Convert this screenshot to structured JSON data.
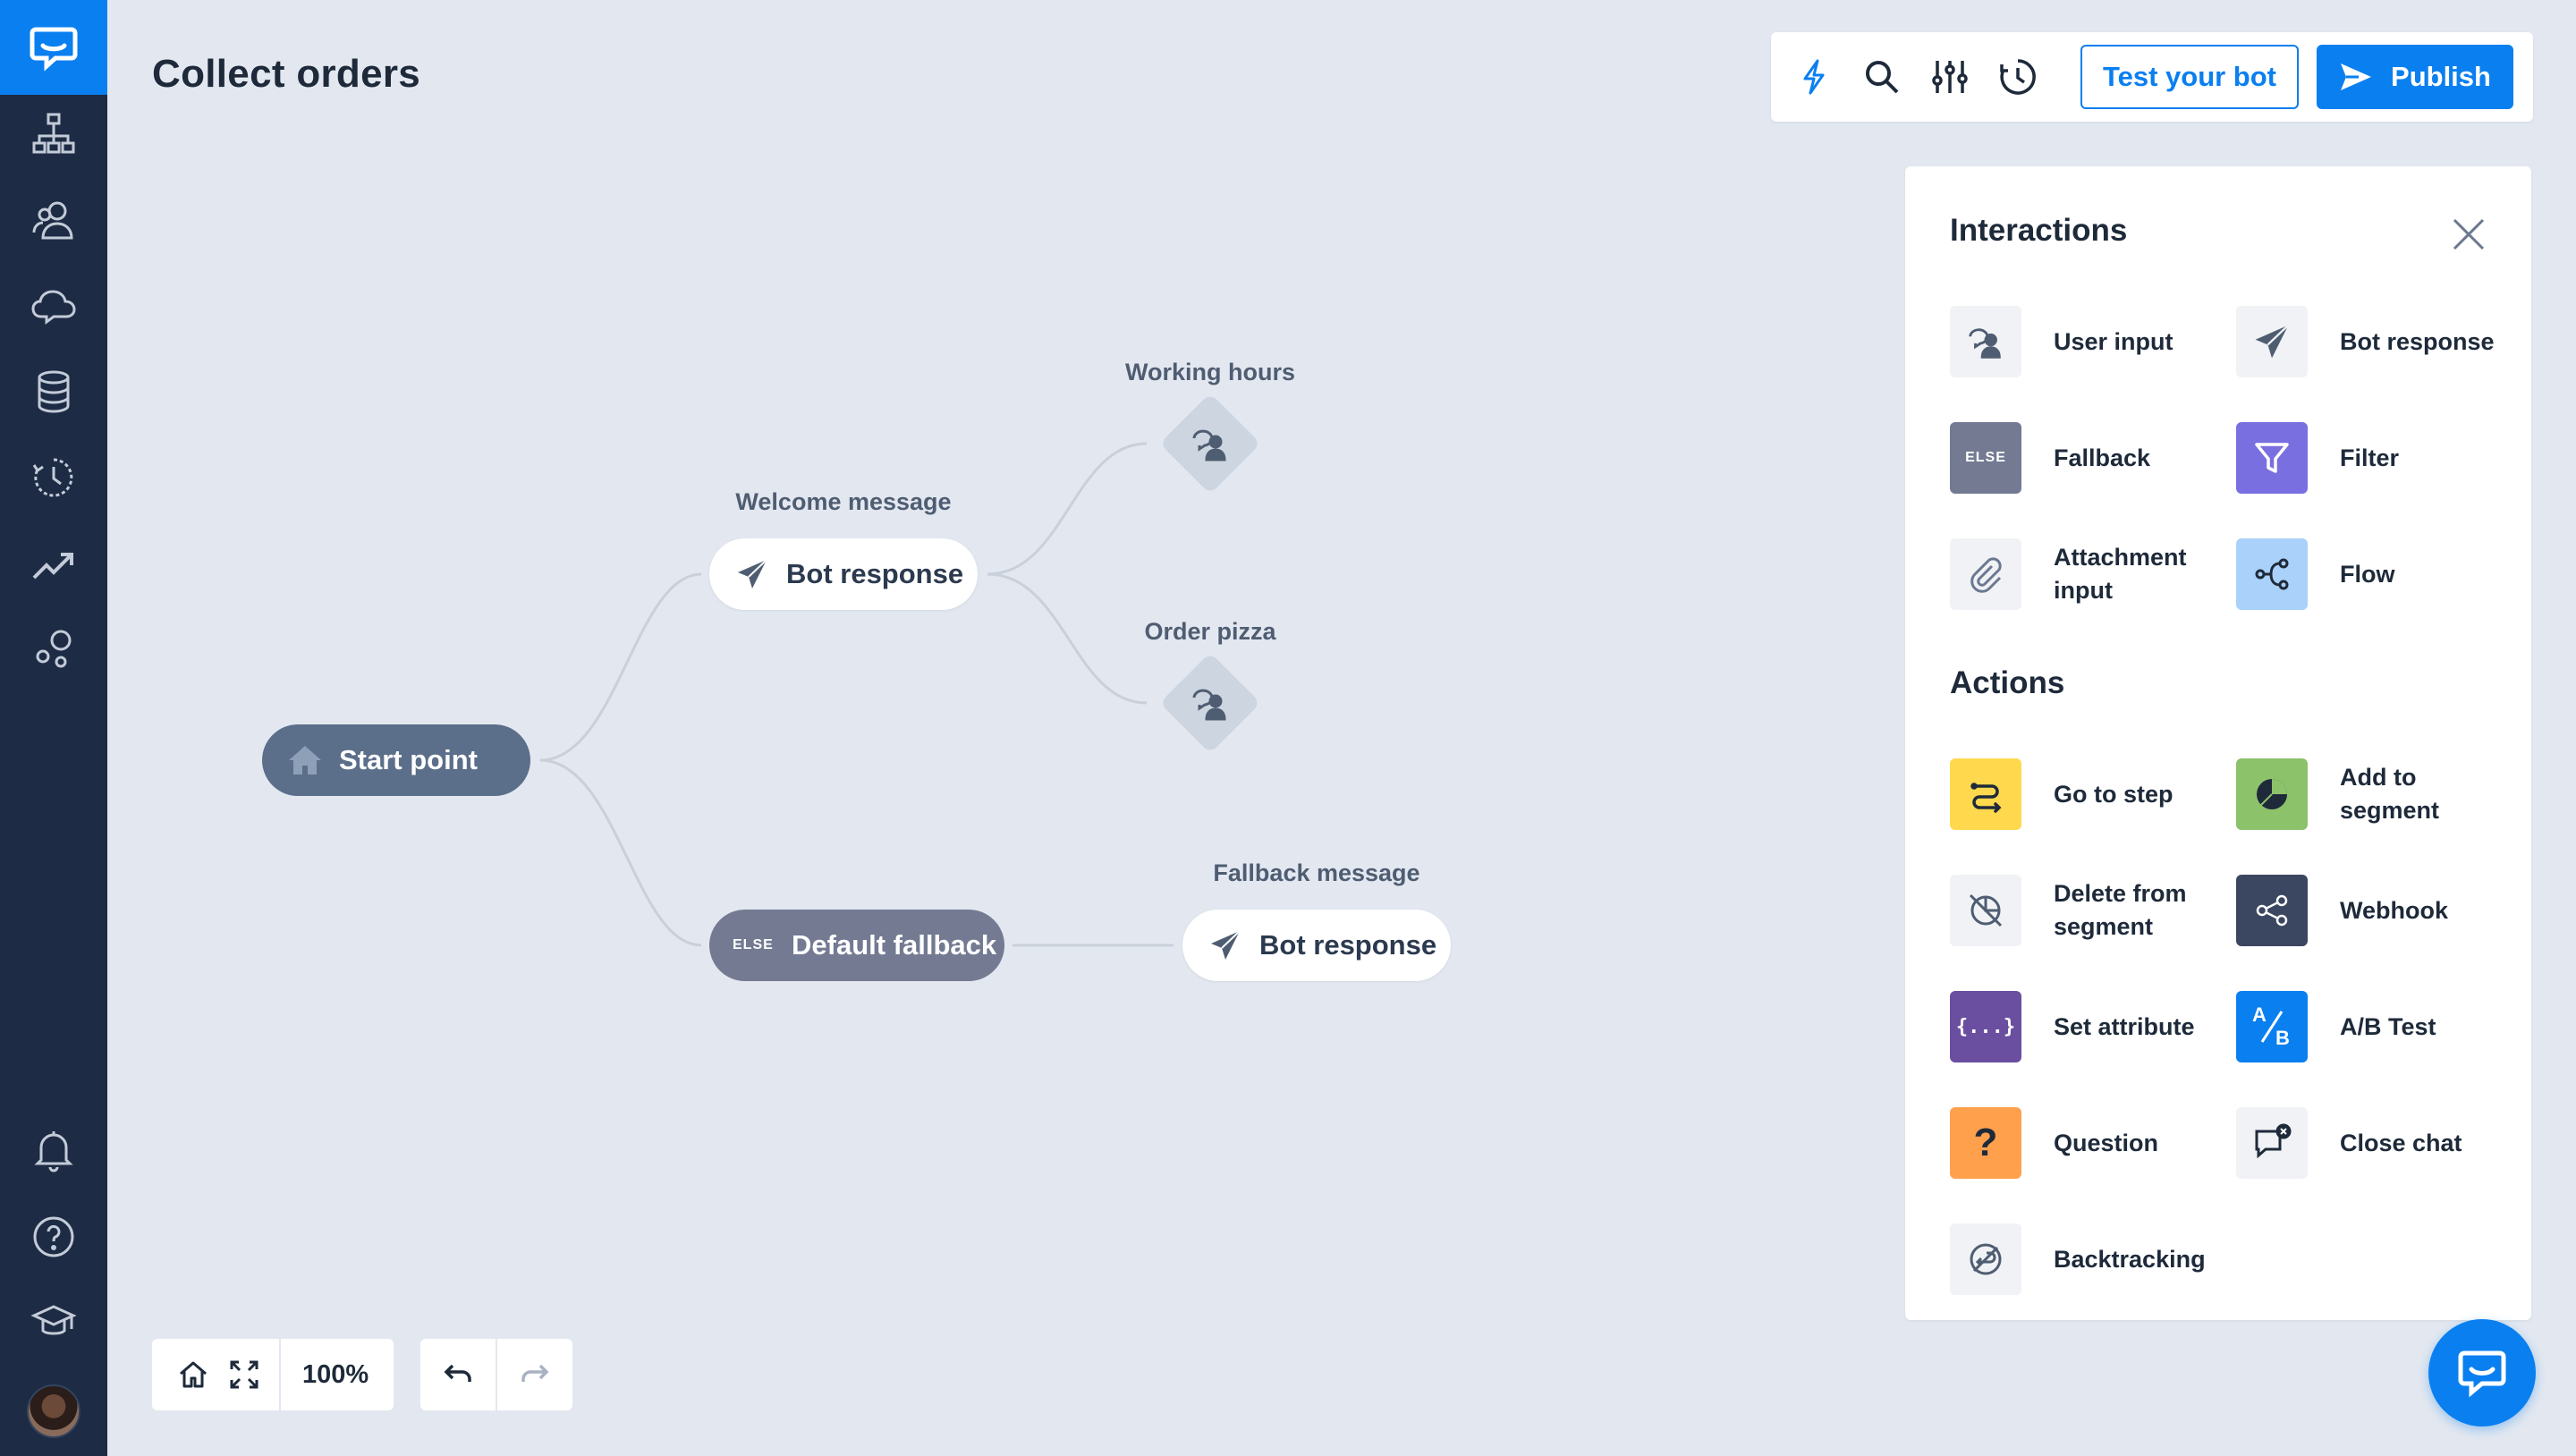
{
  "app": {
    "title": "Collect orders",
    "accent": "#0a7ff0"
  },
  "sidebar": {
    "logo_icon": "chatbot-logo-icon",
    "items": [
      {
        "icon": "hierarchy-icon"
      },
      {
        "icon": "users-icon"
      },
      {
        "icon": "chat-cloud-icon"
      },
      {
        "icon": "database-icon"
      },
      {
        "icon": "history-clock-icon"
      },
      {
        "icon": "analytics-trend-icon"
      },
      {
        "icon": "integrations-bubbles-icon"
      }
    ],
    "bottom_items": [
      {
        "icon": "bell-icon"
      },
      {
        "icon": "help-icon"
      },
      {
        "icon": "graduation-cap-icon"
      }
    ]
  },
  "toolbar": {
    "icons": [
      "lightning-icon",
      "search-icon",
      "sliders-icon",
      "history-icon"
    ],
    "test_label": "Test your bot",
    "publish_label": "Publish"
  },
  "canvas": {
    "start": {
      "label": "Start point"
    },
    "welcome": {
      "caption": "Welcome message",
      "label": "Bot response"
    },
    "working_hours": {
      "caption": "Working hours"
    },
    "order_pizza": {
      "caption": "Order pizza"
    },
    "fallback": {
      "tag": "ELSE",
      "label": "Default fallback"
    },
    "fallback_msg": {
      "caption": "Fallback message",
      "label": "Bot response"
    }
  },
  "panel": {
    "interactions_title": "Interactions",
    "interactions": [
      {
        "label": "User input",
        "icon": "user-input-icon",
        "color": "#f0f2f5"
      },
      {
        "label": "Bot response",
        "icon": "paper-plane-icon",
        "color": "#f0f2f5"
      },
      {
        "label": "Fallback",
        "icon": "else-icon",
        "color": "#737a92",
        "tag": "ELSE"
      },
      {
        "label": "Filter",
        "icon": "funnel-icon",
        "color": "#7a6fe0"
      },
      {
        "label": "Attachment input",
        "icon": "paperclip-icon",
        "color": "#f0f2f5"
      },
      {
        "label": "Flow",
        "icon": "flow-icon",
        "color": "#a9d1fa"
      }
    ],
    "actions_title": "Actions",
    "actions": [
      {
        "label": "Go to step",
        "icon": "go-to-step-icon",
        "color": "#ffd84d"
      },
      {
        "label": "Add to segment",
        "icon": "pie-segment-icon",
        "color": "#8cc26a"
      },
      {
        "label": "Delete from segment",
        "icon": "segment-remove-icon",
        "color": "#f0f2f5"
      },
      {
        "label": "Webhook",
        "icon": "share-nodes-icon",
        "color": "#3b4660"
      },
      {
        "label": "Set attribute",
        "icon": "braces-icon",
        "color": "#6a4fa0",
        "glyph": "{...}"
      },
      {
        "label": "A/B Test",
        "icon": "ab-test-icon",
        "color": "#0a7ff0",
        "glyph_a": "A",
        "glyph_b": "B"
      },
      {
        "label": "Question",
        "icon": "question-mark-icon",
        "color": "#ffa04d",
        "glyph": "?"
      },
      {
        "label": "Close chat",
        "icon": "close-chat-icon",
        "color": "#f0f2f5"
      },
      {
        "label": "Backtracking",
        "icon": "backtracking-icon",
        "color": "#f0f2f5"
      }
    ]
  },
  "controls": {
    "zoom": "100%",
    "icons": [
      "home-icon",
      "fit-screen-icon",
      "undo-icon",
      "redo-icon"
    ]
  },
  "chat_widget": {
    "icon": "chat-bubble-icon"
  }
}
